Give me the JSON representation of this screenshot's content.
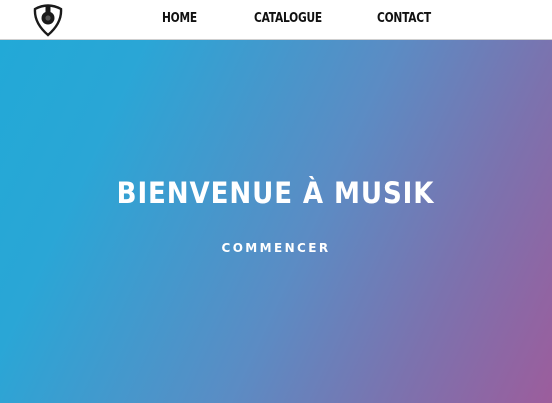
{
  "header": {
    "logo_icon": "guitar-pick-icon",
    "nav": [
      {
        "label": "HOME"
      },
      {
        "label": "CATALOGUE"
      },
      {
        "label": "CONTACT"
      }
    ]
  },
  "hero": {
    "title": "BIENVENUE À MUSIK",
    "cta_label": "COMMENCER",
    "gradient_colors": [
      "#22a9d7",
      "#5b8cc4",
      "#9c5d9c"
    ]
  }
}
